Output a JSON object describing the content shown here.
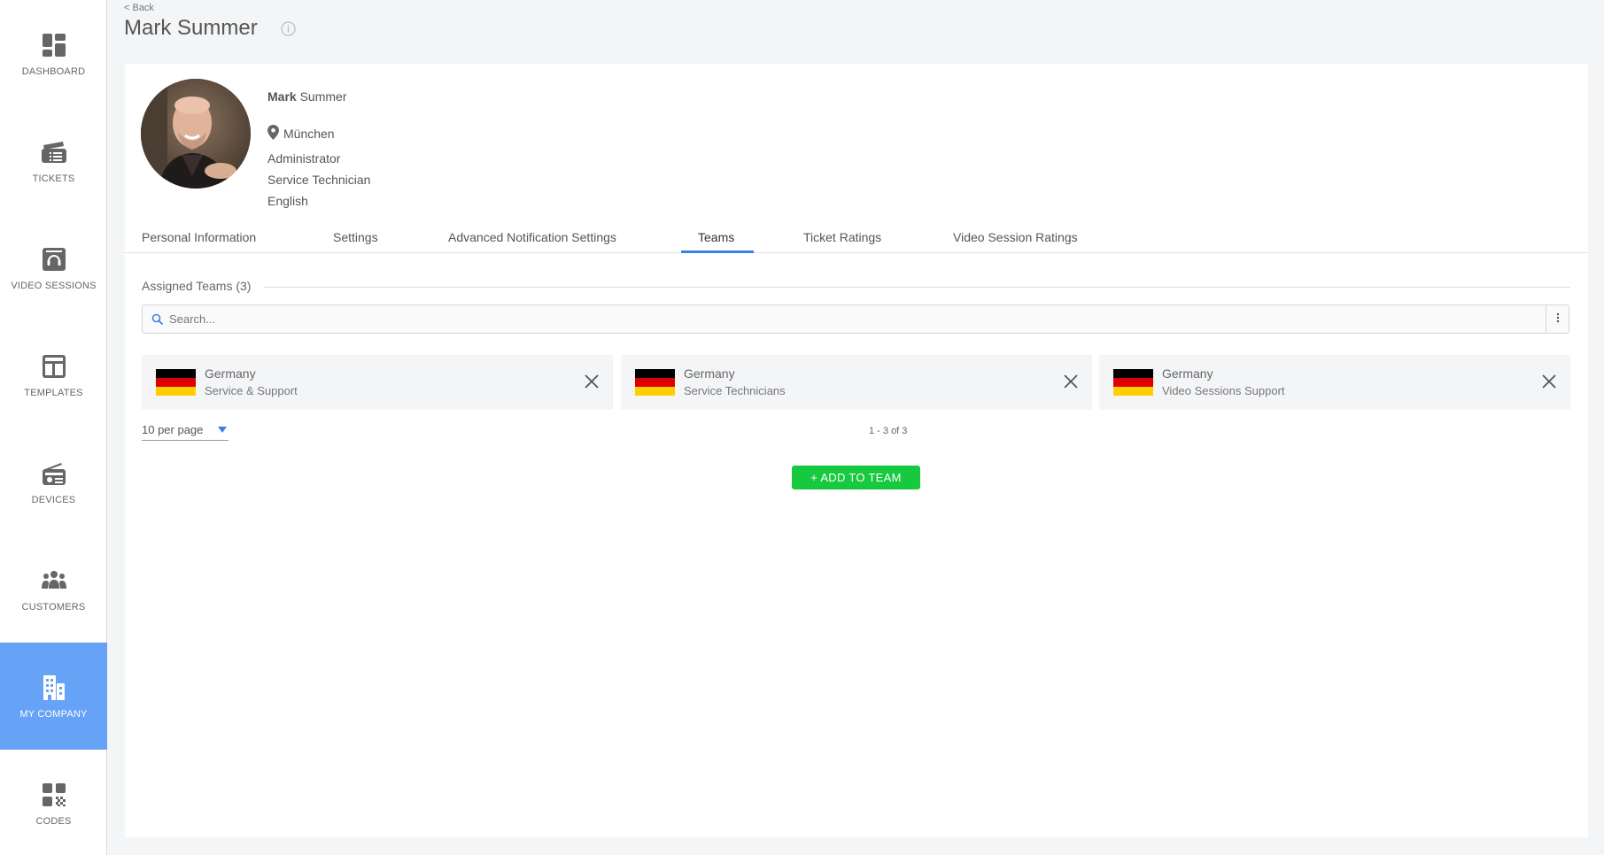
{
  "sidebar": {
    "items": [
      {
        "label": "DASHBOARD",
        "icon": "dashboard-icon"
      },
      {
        "label": "TICKETS",
        "icon": "tickets-icon"
      },
      {
        "label": "VIDEO SESSIONS",
        "icon": "video-sessions-icon"
      },
      {
        "label": "TEMPLATES",
        "icon": "templates-icon"
      },
      {
        "label": "DEVICES",
        "icon": "devices-icon"
      },
      {
        "label": "CUSTOMERS",
        "icon": "customers-icon"
      },
      {
        "label": "MY COMPANY",
        "icon": "company-icon",
        "active": true
      },
      {
        "label": "CODES",
        "icon": "qr-code-icon"
      }
    ]
  },
  "header": {
    "back": "< Back",
    "title": "Mark Summer"
  },
  "profile": {
    "first_name": "Mark",
    "last_name": "Summer",
    "location": "München",
    "role": "Administrator",
    "position": "Service Technician",
    "language": "English"
  },
  "tabs": [
    {
      "label": "Personal Information"
    },
    {
      "label": "Settings"
    },
    {
      "label": "Advanced Notification Settings"
    },
    {
      "label": "Teams",
      "active": true
    },
    {
      "label": "Ticket Ratings"
    },
    {
      "label": "Video Session Ratings"
    }
  ],
  "teams": {
    "section_title": "Assigned Teams",
    "count": "(3)",
    "search_placeholder": "Search...",
    "items": [
      {
        "country": "Germany",
        "name": "Service & Support"
      },
      {
        "country": "Germany",
        "name": "Service Technicians"
      },
      {
        "country": "Germany",
        "name": "Video Sessions Support"
      }
    ],
    "per_page": "10 per page",
    "pagination": "1 - 3 of 3",
    "add_button": "+ ADD TO TEAM"
  },
  "colors": {
    "accent": "#3b82e0",
    "active_nav": "#66a3f7",
    "add_button": "#16c93f",
    "flag_black": "#000000",
    "flag_red": "#dd0000",
    "flag_gold": "#ffce00"
  }
}
